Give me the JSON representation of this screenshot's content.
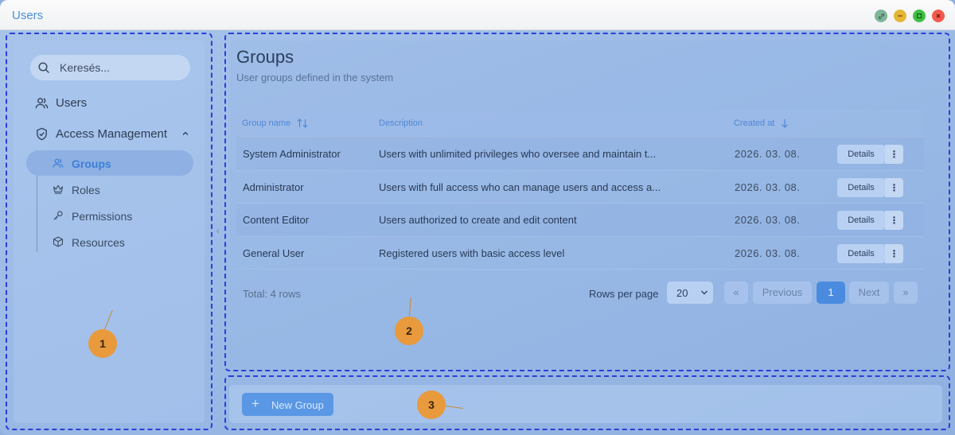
{
  "window": {
    "title": "Users"
  },
  "colors": {
    "accent": "#4a8be0",
    "zone_border": "#2a3fd8",
    "marker": "#e89a3c"
  },
  "sidebar": {
    "search_placeholder": "Keresés...",
    "nav": {
      "users": "Users",
      "access_management": "Access Management"
    },
    "sub_items": [
      {
        "label": "Groups",
        "icon": "users-icon",
        "active": true
      },
      {
        "label": "Roles",
        "icon": "crown-icon",
        "active": false
      },
      {
        "label": "Permissions",
        "icon": "key-icon",
        "active": false
      },
      {
        "label": "Resources",
        "icon": "cube-icon",
        "active": false
      }
    ]
  },
  "main": {
    "title": "Groups",
    "subtitle": "User groups defined in the system",
    "table": {
      "columns": {
        "name": "Group name",
        "description": "Description",
        "created": "Created at"
      },
      "rows": [
        {
          "name": "System Administrator",
          "description": "Users with unlimited privileges who oversee and maintain t...",
          "created": "2026. 03. 08.",
          "action": "Details"
        },
        {
          "name": "Administrator",
          "description": "Users with full access who can manage users and access a...",
          "created": "2026. 03. 08.",
          "action": "Details"
        },
        {
          "name": "Content Editor",
          "description": "Users authorized to create and edit content",
          "created": "2026. 03. 08.",
          "action": "Details"
        },
        {
          "name": "General User",
          "description": "Registered users with basic access level",
          "created": "2026. 03. 08.",
          "action": "Details"
        }
      ]
    },
    "footer": {
      "total": "Total: 4 rows",
      "rows_per_page_label": "Rows per page",
      "rows_per_page_value": "20",
      "first": "«",
      "previous": "Previous",
      "current_page": "1",
      "next": "Next",
      "last": "»"
    }
  },
  "bottom": {
    "new_group_label": "New Group"
  },
  "markers": {
    "one": "1",
    "two": "2",
    "three": "3"
  }
}
